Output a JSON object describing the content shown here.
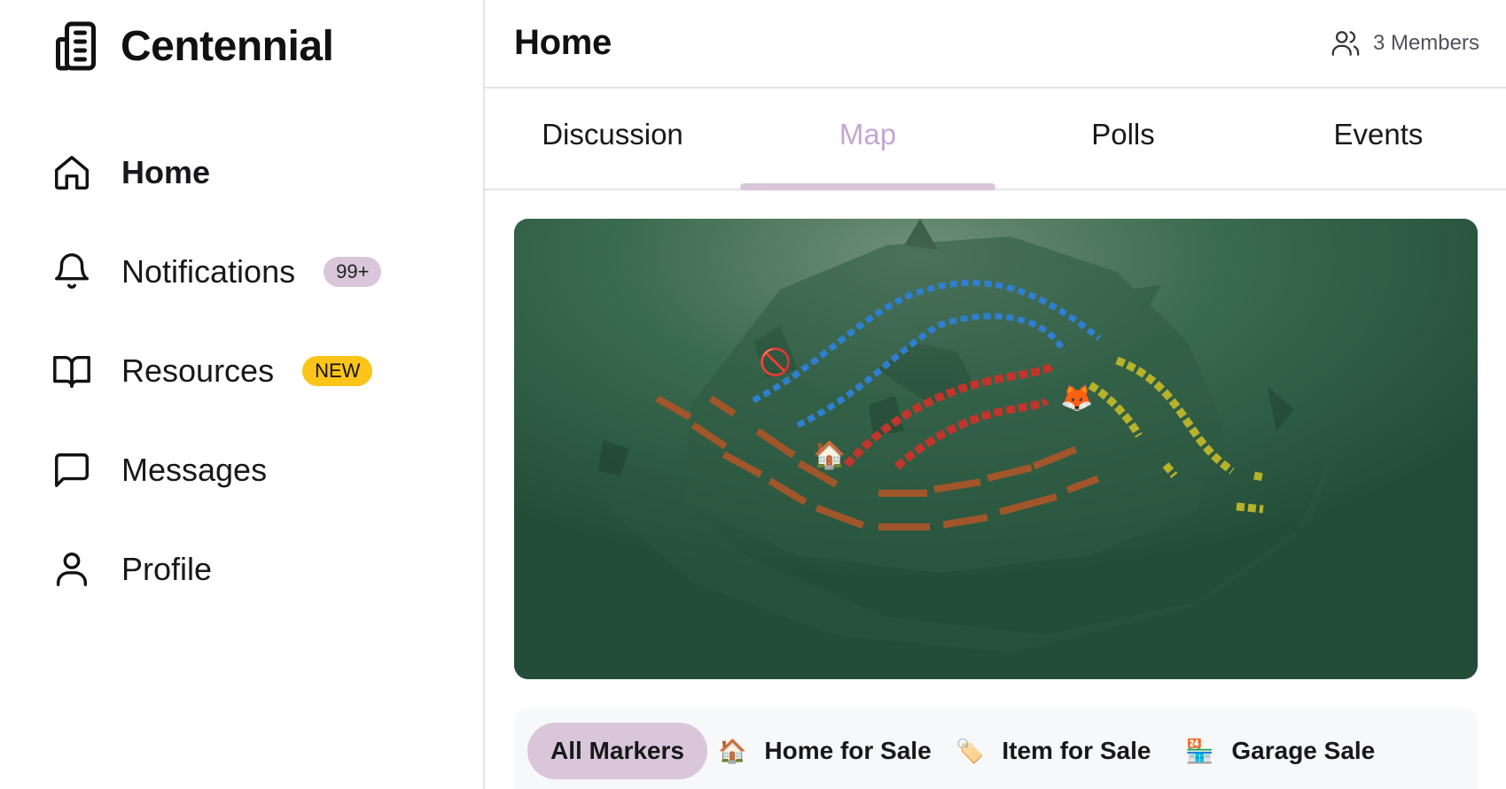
{
  "app": {
    "name": "Centennial",
    "logo_icon": "building-icon"
  },
  "sidebar": {
    "items": [
      {
        "label": "Home",
        "icon": "home-icon",
        "active": true
      },
      {
        "label": "Notifications",
        "icon": "bell-icon",
        "badge": "99+"
      },
      {
        "label": "Resources",
        "icon": "book-icon",
        "badge": "NEW"
      },
      {
        "label": "Messages",
        "icon": "message-icon"
      },
      {
        "label": "Profile",
        "icon": "user-icon"
      }
    ]
  },
  "header": {
    "title": "Home",
    "members": "3 Members",
    "members_icon": "users-icon"
  },
  "tabs": [
    {
      "label": "Discussion",
      "active": false
    },
    {
      "label": "Map",
      "active": true
    },
    {
      "label": "Polls",
      "active": false
    },
    {
      "label": "Events",
      "active": false
    }
  ],
  "map": {
    "markers": [
      {
        "type": "no-entry",
        "emoji": "🚫"
      },
      {
        "type": "home",
        "emoji": "🏠"
      },
      {
        "type": "fox",
        "emoji": "🦊"
      }
    ]
  },
  "filters": [
    {
      "label": "All Markers",
      "emoji": "",
      "active": true
    },
    {
      "label": "Home for Sale",
      "emoji": "🏠",
      "active": false
    },
    {
      "label": "Item for Sale",
      "emoji": "🏷️",
      "active": false
    },
    {
      "label": "Garage Sale",
      "emoji": "🏪",
      "active": false
    }
  ],
  "colors": {
    "accent_lavender": "#d9c6db",
    "active_tab_text": "#c6a7cf",
    "new_badge": "#fcc419",
    "map_green": "#244f39"
  }
}
